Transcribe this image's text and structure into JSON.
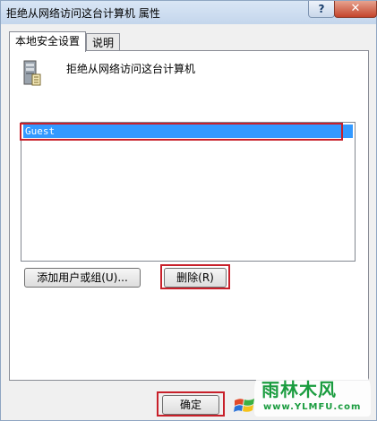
{
  "window": {
    "title": "拒绝从网络访问这台计算机 属性",
    "help_label": "?",
    "close_label": "✕"
  },
  "tabs": [
    {
      "label": "本地安全设置"
    },
    {
      "label": "说明"
    }
  ],
  "policy": {
    "name": "拒绝从网络访问这台计算机",
    "icon": "server-icon"
  },
  "list": {
    "items": [
      "Guest"
    ],
    "selected": "Guest"
  },
  "buttons": {
    "add": "添加用户或组(U)...",
    "remove": "删除(R)",
    "ok": "确定"
  },
  "watermark": {
    "text": "雨林木风",
    "url": "www.YLMFU.com"
  },
  "colors": {
    "selection": "#3399ff",
    "highlight_box": "#c8202a",
    "watermark": "#1a9c3f"
  }
}
